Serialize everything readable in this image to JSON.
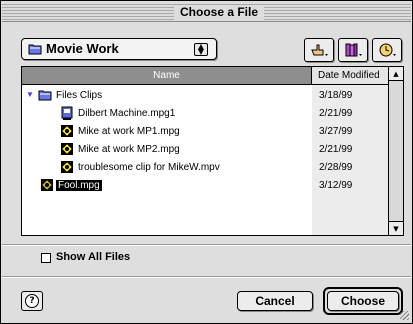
{
  "window": {
    "title": "Choose a File"
  },
  "location_popup": {
    "label": "Movie Work",
    "icon": "folder-icon"
  },
  "toolbar": {
    "buttons": [
      {
        "name": "shortcuts-button",
        "icon": "hand-icon"
      },
      {
        "name": "favorites-button",
        "icon": "books-icon"
      },
      {
        "name": "recent-button",
        "icon": "clock-icon"
      }
    ]
  },
  "file_list": {
    "columns": [
      "Name",
      "Date Modified"
    ],
    "rows": [
      {
        "name": "Files Clips",
        "date": "3/18/99",
        "kind": "folder",
        "expanded": true,
        "indent": 0
      },
      {
        "name": "Dilbert Machine.mpg1",
        "date": "2/21/99",
        "kind": "movie",
        "indent": 1
      },
      {
        "name": "Mike at work MP1.mpg",
        "date": "3/27/99",
        "kind": "movie",
        "indent": 1
      },
      {
        "name": "Mike at work MP2.mpg",
        "date": "2/21/99",
        "kind": "movie",
        "indent": 1
      },
      {
        "name": "troublesome clip for MikeW.mpv",
        "date": "2/28/99",
        "kind": "movie",
        "indent": 1
      },
      {
        "name": "Fool.mpg",
        "date": "3/12/99",
        "kind": "movie",
        "indent": 0,
        "selected": true
      }
    ]
  },
  "options": {
    "show_all_files_label": "Show All Files",
    "show_all_files_checked": false
  },
  "buttons": {
    "help": "?",
    "cancel": "Cancel",
    "choose": "Choose"
  },
  "colors": {
    "header_selected": "#8e8e8e",
    "window_bg": "#dedede",
    "folder_blue": "#4a5ad8"
  }
}
